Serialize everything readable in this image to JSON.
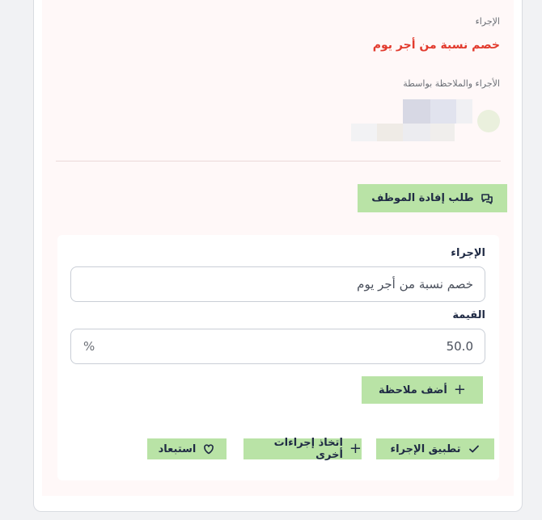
{
  "record": {
    "action_label": "الإجراء",
    "action_value": "خصم نسبة من أجر يوم",
    "by_label": "الأجراء والملاحظة بواسطة"
  },
  "request_feedback_button": "طلب إفادة الموظف",
  "form": {
    "action_label": "الإجراء",
    "action_value": "خصم نسبة من أجر يوم",
    "value_label": "القيمة",
    "value": "50.0",
    "value_unit": "%",
    "add_note_button": "أضف ملاحظة"
  },
  "footer_buttons": {
    "apply": "تطبيق الإجراء",
    "other": "اتخاذ إجراءات أخرى",
    "exclude": "استبعاد"
  },
  "colors": {
    "accent_green": "#b9e3a6",
    "danger_text": "#e23b2e",
    "navy_text": "#1f2a44"
  }
}
